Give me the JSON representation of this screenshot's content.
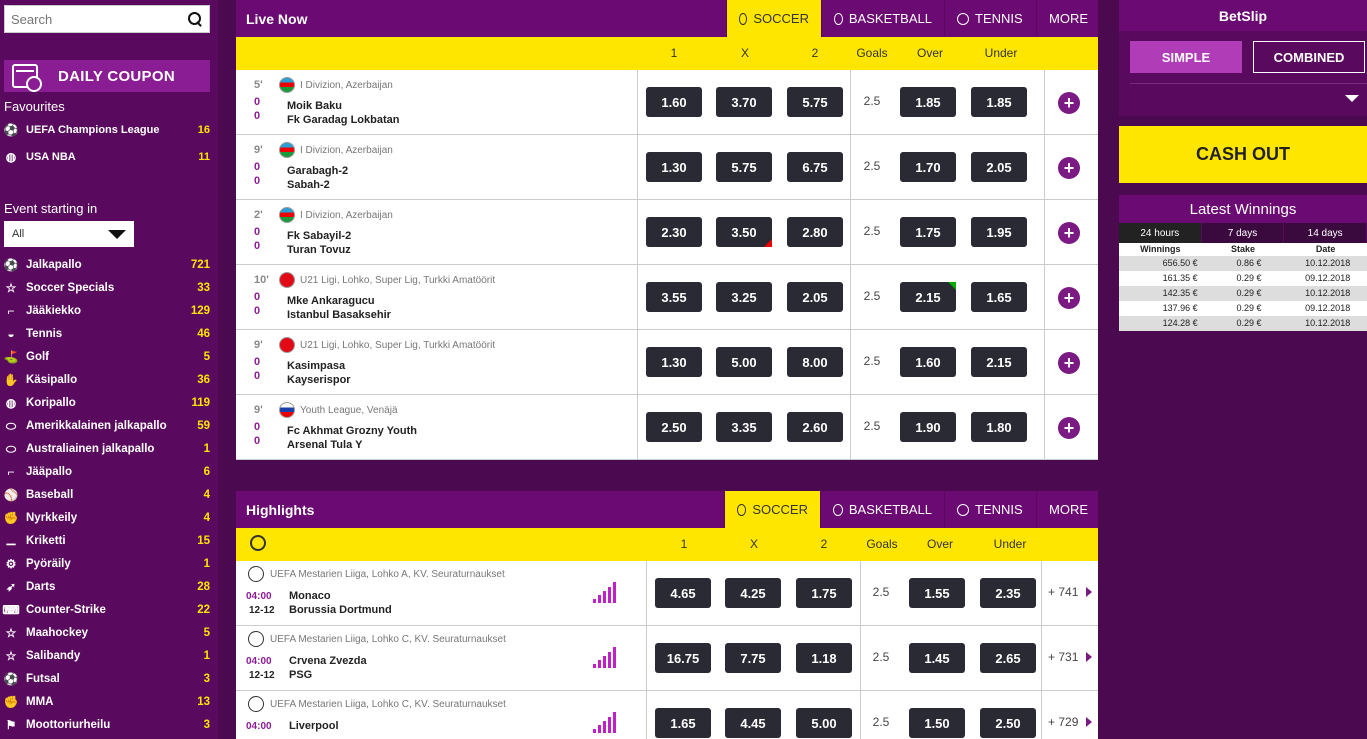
{
  "search": {
    "placeholder": "Search"
  },
  "daily_coupon": "DAILY COUPON",
  "favourites_title": "Favourites",
  "favourites": [
    {
      "label": "UEFA Champions League",
      "count": "16",
      "icon": "soccer-icon"
    },
    {
      "label": "USA NBA",
      "count": "11",
      "icon": "basketball-icon"
    }
  ],
  "event_starting": {
    "title": "Event starting in",
    "selected": "All"
  },
  "sports": [
    {
      "label": "Jalkapallo",
      "count": "721",
      "icon": "soccer-icon"
    },
    {
      "label": "Soccer Specials",
      "count": "33",
      "icon": "star-icon"
    },
    {
      "label": "Jääkiekko",
      "count": "129",
      "icon": "hockey-icon"
    },
    {
      "label": "Tennis",
      "count": "46",
      "icon": "tennis-icon"
    },
    {
      "label": "Golf",
      "count": "5",
      "icon": "golf-icon"
    },
    {
      "label": "Käsipallo",
      "count": "36",
      "icon": "handball-icon"
    },
    {
      "label": "Koripallo",
      "count": "119",
      "icon": "basketball-icon"
    },
    {
      "label": "Amerikkalainen jalkapallo",
      "count": "59",
      "icon": "american-football-icon"
    },
    {
      "label": "Australiainen jalkapallo",
      "count": "1",
      "icon": "aussie-rules-icon"
    },
    {
      "label": "Jääpallo",
      "count": "6",
      "icon": "bandy-icon"
    },
    {
      "label": "Baseball",
      "count": "4",
      "icon": "baseball-icon"
    },
    {
      "label": "Nyrkkeily",
      "count": "4",
      "icon": "boxing-icon"
    },
    {
      "label": "Kriketti",
      "count": "15",
      "icon": "cricket-icon"
    },
    {
      "label": "Pyöräily",
      "count": "1",
      "icon": "cycling-icon"
    },
    {
      "label": "Darts",
      "count": "28",
      "icon": "darts-icon"
    },
    {
      "label": "Counter-Strike",
      "count": "22",
      "icon": "esports-icon"
    },
    {
      "label": "Maahockey",
      "count": "5",
      "icon": "star-icon"
    },
    {
      "label": "Salibandy",
      "count": "1",
      "icon": "star-icon"
    },
    {
      "label": "Futsal",
      "count": "3",
      "icon": "soccer-icon"
    },
    {
      "label": "MMA",
      "count": "13",
      "icon": "mma-icon"
    },
    {
      "label": "Moottoriurheilu",
      "count": "3",
      "icon": "motorsport-icon"
    }
  ],
  "live": {
    "title": "Live Now",
    "tabs": [
      "SOCCER",
      "BASKETBALL",
      "TENNIS",
      "MORE"
    ],
    "cols": [
      "1",
      "X",
      "2",
      "Goals",
      "Over",
      "Under"
    ],
    "rows": [
      {
        "minute": "5'",
        "s1": "0",
        "s2": "0",
        "league": "I Divizion, Azerbaijan",
        "home": "Moik Baku",
        "away": "Fk Garadag Lokbatan",
        "o1": "1.60",
        "ox": "3.70",
        "o2": "5.75",
        "goals": "2.5",
        "over": "1.85",
        "under": "1.85"
      },
      {
        "minute": "9'",
        "s1": "0",
        "s2": "0",
        "league": "I Divizion, Azerbaijan",
        "home": "Garabagh-2",
        "away": "Sabah-2",
        "o1": "1.30",
        "ox": "5.75",
        "o2": "6.75",
        "goals": "2.5",
        "over": "1.70",
        "under": "2.05"
      },
      {
        "minute": "2'",
        "s1": "0",
        "s2": "0",
        "league": "I Divizion, Azerbaijan",
        "home": "Fk Sabayil-2",
        "away": "Turan Tovuz",
        "o1": "2.30",
        "ox": "3.50",
        "o2": "2.80",
        "goals": "2.5",
        "over": "1.75",
        "under": "1.95"
      },
      {
        "minute": "10'",
        "s1": "0",
        "s2": "0",
        "league": "U21 Ligi, Lohko, Super Lig, Turkki Amatöörit",
        "home": "Mke Ankaragucu",
        "away": "Istanbul Basaksehir",
        "o1": "3.55",
        "ox": "3.25",
        "o2": "2.05",
        "goals": "2.5",
        "over": "2.15",
        "under": "1.65"
      },
      {
        "minute": "9'",
        "s1": "0",
        "s2": "0",
        "league": "U21 Ligi, Lohko, Super Lig, Turkki Amatöörit",
        "home": "Kasimpasa",
        "away": "Kayserispor",
        "o1": "1.30",
        "ox": "5.00",
        "o2": "8.00",
        "goals": "2.5",
        "over": "1.60",
        "under": "2.15"
      },
      {
        "minute": "9'",
        "s1": "0",
        "s2": "0",
        "league": "Youth League, Venäjä",
        "home": "Fc Akhmat Grozny Youth",
        "away": "Arsenal Tula Y",
        "o1": "2.50",
        "ox": "3.35",
        "o2": "2.60",
        "goals": "2.5",
        "over": "1.90",
        "under": "1.80"
      }
    ]
  },
  "highlights": {
    "title": "Highlights",
    "tabs": [
      "SOCCER",
      "BASKETBALL",
      "TENNIS",
      "MORE"
    ],
    "cols": [
      "1",
      "X",
      "2",
      "Goals",
      "Over",
      "Under"
    ],
    "rows": [
      {
        "league": "UEFA Mestarien Liiga, Lohko A, KV. Seuraturnaukset",
        "time": "04:00",
        "date": "12-12",
        "home": "Monaco",
        "away": "Borussia Dortmund",
        "o1": "4.65",
        "ox": "4.25",
        "o2": "1.75",
        "goals": "2.5",
        "over": "1.55",
        "under": "2.35",
        "more": "+ 741"
      },
      {
        "league": "UEFA Mestarien Liiga, Lohko C, KV. Seuraturnaukset",
        "time": "04:00",
        "date": "12-12",
        "home": "Crvena Zvezda",
        "away": "PSG",
        "o1": "16.75",
        "ox": "7.75",
        "o2": "1.18",
        "goals": "2.5",
        "over": "1.45",
        "under": "2.65",
        "more": "+ 731"
      },
      {
        "league": "UEFA Mestarien Liiga, Lohko C, KV. Seuraturnaukset",
        "time": "04:00",
        "date": "",
        "home": "Liverpool",
        "away": "",
        "o1": "1.65",
        "ox": "4.45",
        "o2": "5.00",
        "goals": "2.5",
        "over": "1.50",
        "under": "2.50",
        "more": "+ 729"
      }
    ]
  },
  "betslip": {
    "title": "BetSlip",
    "simple": "SIMPLE",
    "combined": "COMBINED",
    "cashout": "CASH OUT"
  },
  "latest": {
    "title": "Latest Winnings",
    "tabs": [
      "24 hours",
      "7 days",
      "14 days"
    ],
    "cols": [
      "Winnings",
      "Stake",
      "Date"
    ],
    "rows": [
      [
        "656.50 €",
        "0.86 €",
        "10.12.2018"
      ],
      [
        "161.35 €",
        "0.29 €",
        "09.12.2018"
      ],
      [
        "142.35 €",
        "0.29 €",
        "10.12.2018"
      ],
      [
        "137.96 €",
        "0.29 €",
        "09.12.2018"
      ],
      [
        "124.28 €",
        "0.29 €",
        "10.12.2018"
      ]
    ]
  },
  "colors": {
    "purple": "#6a0a72",
    "yellow": "#ffe600",
    "odds_bg": "#2a2a35"
  }
}
